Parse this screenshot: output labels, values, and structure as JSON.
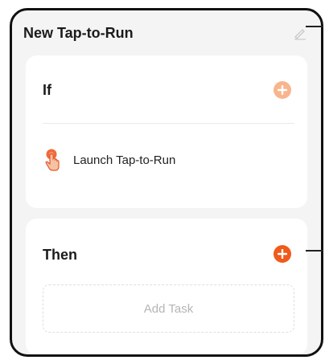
{
  "header": {
    "title": "New Tap-to-Run",
    "edit_icon": "pencil-icon"
  },
  "if_section": {
    "title": "If",
    "add_icon": "plus-circle-icon",
    "conditions": [
      {
        "label": "Launch Tap-to-Run",
        "icon": "tap-hand-icon"
      }
    ]
  },
  "then_section": {
    "title": "Then",
    "add_icon": "plus-circle-icon",
    "add_task_label": "Add Task"
  },
  "colors": {
    "accent": "#f05a1a",
    "accent_light": "#f8b58d",
    "background": "#f4f4f4",
    "card": "#ffffff"
  }
}
